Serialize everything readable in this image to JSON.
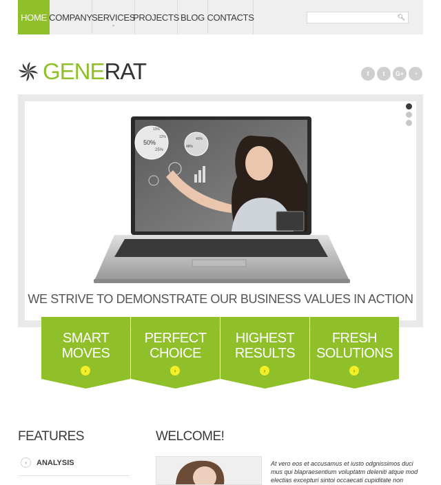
{
  "nav": {
    "items": [
      {
        "label": "Home",
        "active": true
      },
      {
        "label": "Company"
      },
      {
        "label": "Services",
        "has_dropdown": true
      },
      {
        "label": "Projects"
      },
      {
        "label": "Blog"
      },
      {
        "label": "Contacts"
      }
    ]
  },
  "search": {
    "placeholder": "",
    "icon": "search-icon"
  },
  "logo": {
    "part1": "GENE",
    "part2": "RAT",
    "icon": "pinwheel-icon"
  },
  "social": [
    {
      "name": "facebook-icon",
      "glyph": "f"
    },
    {
      "name": "twitter-icon",
      "glyph": "t"
    },
    {
      "name": "google-plus-icon",
      "glyph": "G+"
    },
    {
      "name": "rss-icon",
      "glyph": "◔"
    }
  ],
  "slider": {
    "caption": "WE STRIVE TO DEMONSTRATE OUR BUSINESS VALUES IN ACTION",
    "dots": [
      true,
      false,
      false
    ],
    "screen_labels": [
      "50%",
      "10%",
      "12%",
      "25%",
      "40%",
      "48%"
    ]
  },
  "boxes": [
    {
      "line1": "Smart",
      "line2": "Moves"
    },
    {
      "line1": "Perfect",
      "line2": "Choice"
    },
    {
      "line1": "Highest",
      "line2": "Results"
    },
    {
      "line1": "Fresh",
      "line2": "Solutions"
    }
  ],
  "features": {
    "title": "FEATURES",
    "items": [
      "Analysis"
    ]
  },
  "welcome": {
    "title": "WELCOME!",
    "text": "At vero eos et accusamus et iusto odgnissimos duci mus qui blapraesentium voluptatm deleniti atque mod electias excepturi sintoi occaecati cupiditate non"
  },
  "colors": {
    "accent": "#8fc02a",
    "bullet": "#f4ee26"
  }
}
